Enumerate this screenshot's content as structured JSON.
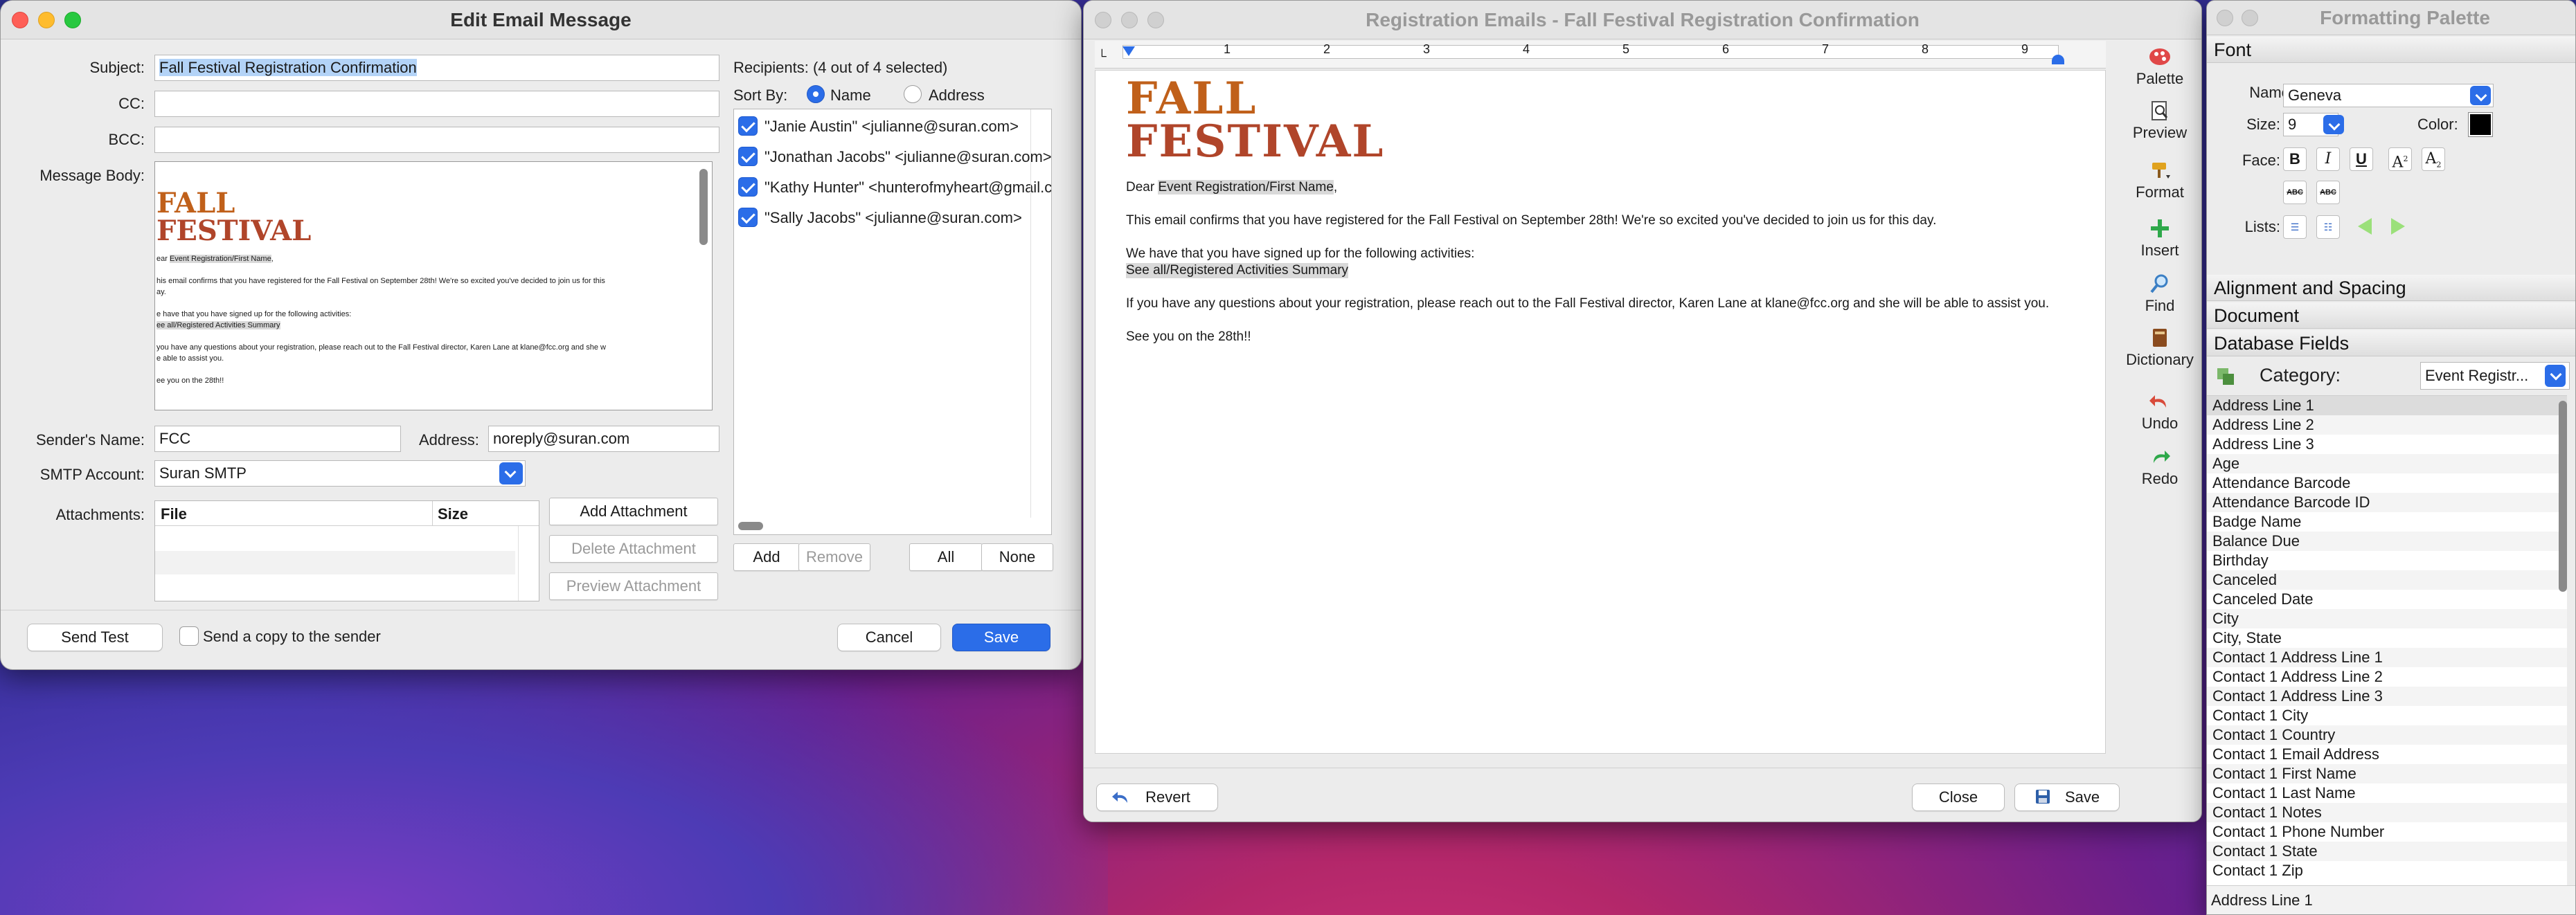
{
  "edit_window": {
    "title": "Edit Email Message",
    "subject_label": "Subject:",
    "subject_value": "Fall Festival Registration Confirmation",
    "cc_label": "CC:",
    "bcc_label": "BCC:",
    "message_body_label": "Message Body:",
    "preview": {
      "logo_line1": "FALL",
      "logo_line2": "FESTIVAL",
      "dear": "ear ",
      "field1": "Event Registration/First Name",
      "dear_end": ",",
      "line1": "his email confirms that you have registered for the Fall Festival on September 28th! We're so excited you've decided to join us for this",
      "line1b": "ay.",
      "line2": "e have that you have signed up for the following activities:",
      "field2": "ee all/Registered Activities Summary",
      "line3": " you have any questions about your registration, please reach out to the Fall Festival director, Karen Lane at klane@fcc.org and she w",
      "line3b": "e able to assist you.",
      "line4": "ee you on the 28th!!"
    },
    "sender_name_label": "Sender's Name:",
    "sender_name_value": "FCC",
    "address_label": "Address:",
    "address_value": "noreply@suran.com",
    "smtp_label": "SMTP Account:",
    "smtp_value": "Suran SMTP",
    "attachments_label": "Attachments:",
    "att_col_file": "File",
    "att_col_size": "Size",
    "add_attachment": "Add Attachment",
    "delete_attachment": "Delete Attachment",
    "preview_attachment": "Preview Attachment",
    "recipients_label": "Recipients: (4 out of 4 selected)",
    "sort_by_label": "Sort By:",
    "sort_name": "Name",
    "sort_address": "Address",
    "recipients": [
      "\"Janie Austin\" <julianne@suran.com>",
      "\"Jonathan Jacobs\" <julianne@suran.com>",
      "\"Kathy Hunter\" <hunterofmyheart@gmail.com>",
      "\"Sally Jacobs\" <julianne@suran.com>"
    ],
    "add": "Add",
    "remove": "Remove",
    "all": "All",
    "none": "None",
    "send_test": "Send Test",
    "send_copy": "Send a copy to the sender",
    "cancel": "Cancel",
    "save": "Save"
  },
  "doc_window": {
    "title": "Registration Emails - Fall Festival Registration Confirmation",
    "ruler_numbers": [
      "1",
      "2",
      "3",
      "4",
      "5",
      "6",
      "7",
      "8",
      "9"
    ],
    "logo_line1": "FALL",
    "logo_line2": "FESTIVAL",
    "dear": "Dear ",
    "field1": "Event Registration/First Name",
    "dear_end": ",",
    "para1": "This email confirms that you have registered for the Fall Festival on September 28th! We're so excited you've decided to join us for this day.",
    "para2": "We have that you have signed up for the following activities:",
    "field2": "See all/Registered Activities Summary",
    "para3": "If you have any questions about your registration, please reach out to the Fall Festival director, Karen Lane at klane@fcc.org and she will be able to assist you.",
    "para4": "See you on the 28th!!",
    "toolbar": {
      "palette": "Palette",
      "preview": "Preview",
      "format": "Format",
      "insert": "Insert",
      "find": "Find",
      "dictionary": "Dictionary",
      "undo": "Undo",
      "redo": "Redo"
    },
    "revert": "Revert",
    "close": "Close",
    "save": "Save"
  },
  "palette_window": {
    "title": "Formatting Palette",
    "font_section": "Font",
    "name_label": "Name:",
    "name_value": "Geneva",
    "size_label": "Size:",
    "size_value": "9",
    "color_label": "Color:",
    "face_label": "Face:",
    "lists_label": "Lists:",
    "alignment_section": "Alignment and Spacing",
    "document_section": "Document",
    "database_section": "Database Fields",
    "category_label": "Category:",
    "category_value": "Event Registr...",
    "fields": [
      "Address Line 1",
      "Address Line 2",
      "Address Line 3",
      "Age",
      "Attendance Barcode",
      "Attendance Barcode ID",
      "Badge Name",
      "Balance Due",
      "Birthday",
      "Canceled",
      "Canceled Date",
      "City",
      "City, State",
      "Contact 1 Address Line 1",
      "Contact 1 Address Line 2",
      "Contact 1 Address Line 3",
      "Contact 1 City",
      "Contact 1 Country",
      "Contact 1 Email Address",
      "Contact 1 First Name",
      "Contact 1 Last Name",
      "Contact 1 Notes",
      "Contact 1 Phone Number",
      "Contact 1 State",
      "Contact 1 Zip"
    ],
    "status": "Address Line 1"
  }
}
